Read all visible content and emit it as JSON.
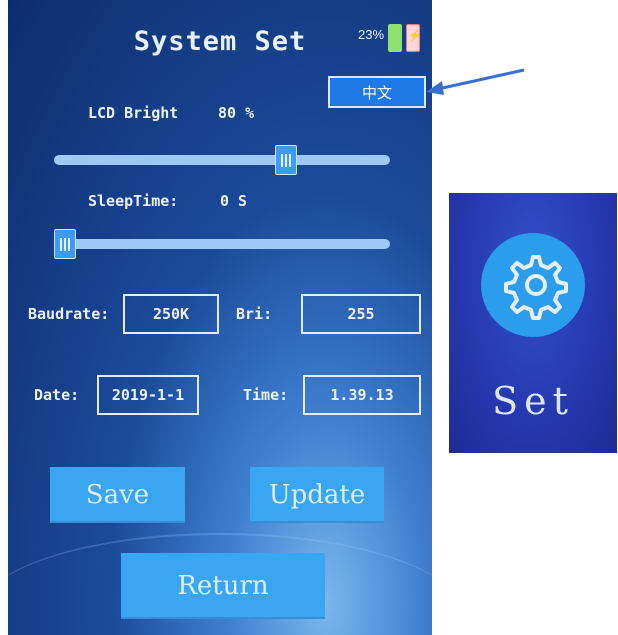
{
  "screen": {
    "title": "System Set",
    "battery_percent": "23%",
    "language_button": "中文",
    "lcd_bright": {
      "label": "LCD Bright",
      "value": "80 %",
      "level": 0.8
    },
    "sleep_time": {
      "label": "SleepTime:",
      "value": "0 S",
      "level": 0.0
    },
    "baudrate": {
      "label": "Baudrate:",
      "value": "250K"
    },
    "bri": {
      "label": "Bri:",
      "value": "255"
    },
    "date": {
      "label": "Date:",
      "value": "2019-1-1"
    },
    "time": {
      "label": "Time:",
      "value": "1.39.13"
    },
    "buttons": {
      "save": "Save",
      "update": "Update",
      "return": "Return"
    }
  },
  "set_panel": {
    "label": "Set",
    "icon": "gear-icon"
  },
  "annotation": {
    "icon": "arrow-icon",
    "color": "#3a6fd0"
  },
  "colors": {
    "accent": "#1f7ae8",
    "button": "#3aa6f2",
    "battery_green": "#8fe06e"
  }
}
